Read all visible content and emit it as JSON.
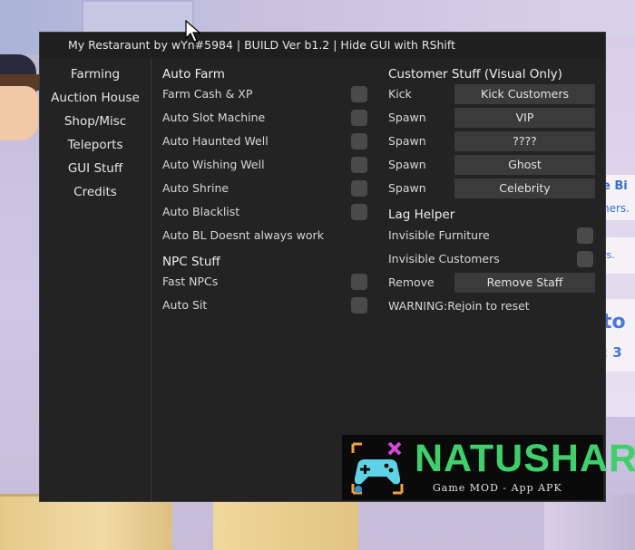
{
  "window": {
    "title": "My Restaraunt by wYn#5984 | BUILD Ver b1.2 | Hide GUI with RShift"
  },
  "sidebar": {
    "items": [
      {
        "label": "Farming"
      },
      {
        "label": "Auction House"
      },
      {
        "label": "Shop/Misc"
      },
      {
        "label": "Teleports"
      },
      {
        "label": "GUI Stuff"
      },
      {
        "label": "Credits"
      }
    ]
  },
  "auto_farm": {
    "heading": "Auto Farm",
    "toggles": [
      {
        "label": "Farm Cash & XP",
        "checked": false
      },
      {
        "label": "Auto Slot Machine",
        "checked": false
      },
      {
        "label": "Auto Haunted Well",
        "checked": false
      },
      {
        "label": "Auto Wishing Well",
        "checked": false
      },
      {
        "label": "Auto Shrine",
        "checked": false
      },
      {
        "label": "Auto Blacklist",
        "checked": false
      }
    ],
    "note": "Auto BL Doesnt always work"
  },
  "npc_stuff": {
    "heading": "NPC Stuff",
    "toggles": [
      {
        "label": "Fast NPCs",
        "checked": false
      },
      {
        "label": "Auto Sit",
        "checked": false
      }
    ]
  },
  "customer_stuff": {
    "heading": "Customer Stuff (Visual Only)",
    "rows": [
      {
        "label": "Kick",
        "button": "Kick Customers"
      },
      {
        "label": "Spawn",
        "button": "VIP"
      },
      {
        "label": "Spawn",
        "button": "????"
      },
      {
        "label": "Spawn",
        "button": "Ghost"
      },
      {
        "label": "Spawn",
        "button": "Celebrity"
      }
    ]
  },
  "lag_helper": {
    "heading": "Lag Helper",
    "toggles": [
      {
        "label": "Invisible Furniture",
        "checked": false
      },
      {
        "label": "Invisible Customers",
        "checked": false
      }
    ],
    "remove": {
      "label": "Remove",
      "button": "Remove Staff"
    },
    "warning": "WARNING:Rejoin to reset"
  },
  "background_text": {
    "sign1": "e Bi",
    "sign2": "ners.",
    "sign3": "rs.",
    "sign4": "to",
    "sign5": ": 3"
  },
  "watermark": {
    "title": "NATUSHARE",
    "subtitle": "Game MOD - App APK"
  },
  "colors": {
    "panel": "#232323",
    "checkbox": "#4a4a4a",
    "button": "#3b3b3b",
    "watermark_green": "#3fd06b"
  }
}
